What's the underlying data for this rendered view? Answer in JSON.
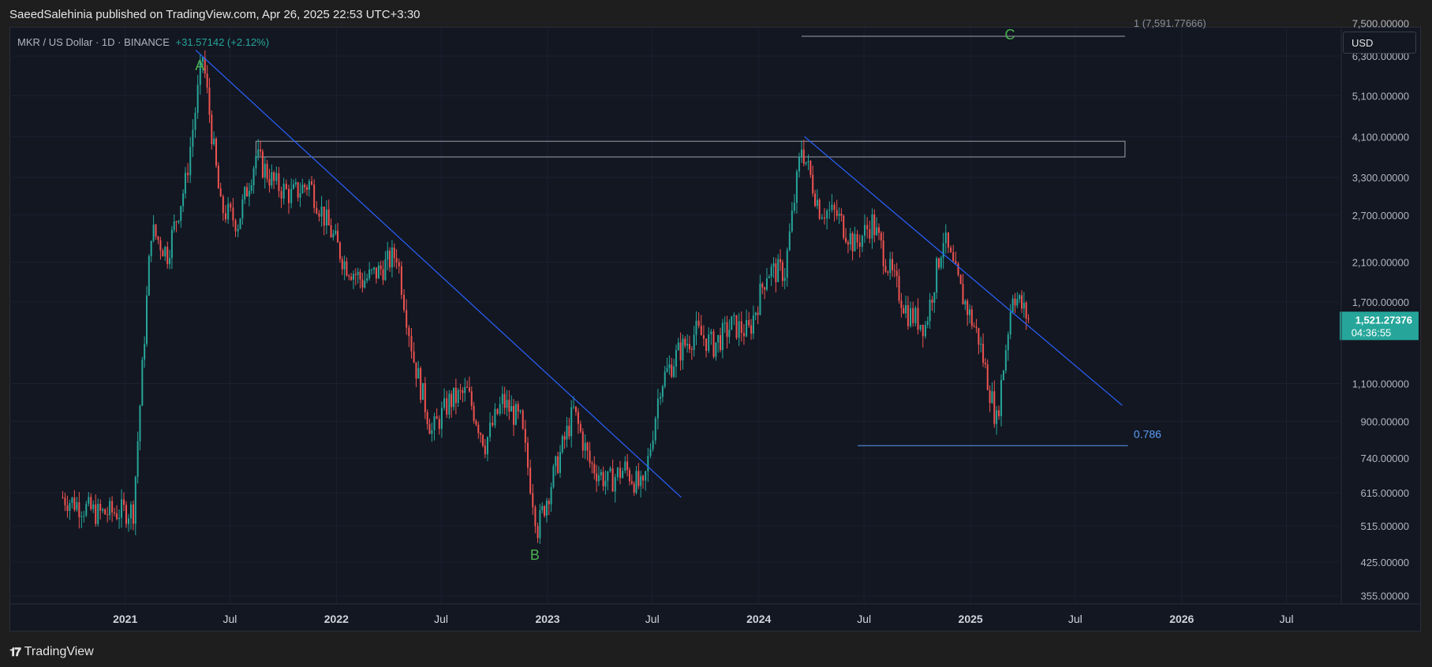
{
  "header": {
    "publish_text": "SaeedSalehinia published on TradingView.com, Apr 26, 2025 22:53 UTC+3:30"
  },
  "symbol": {
    "title": "MKR / US Dollar · 1D · BINANCE",
    "change": "+31.57142 (+2.12%)"
  },
  "currency_button": "USD",
  "footer": {
    "brand": "TradingView"
  },
  "colors": {
    "background": "#131722",
    "up": "#26a69a",
    "down": "#ef5350",
    "trendline": "#2962ff",
    "wave_label": "#4caf50",
    "fib": "#5b9cf6"
  },
  "chart_data": {
    "type": "line",
    "scale": "log",
    "x_labels": [
      "2021",
      "Jul",
      "2022",
      "Jul",
      "2023",
      "Jul",
      "2024",
      "Jul",
      "2025",
      "Jul",
      "2026",
      "Jul"
    ],
    "y_labels": [
      "7,500.00000",
      "6,300.00000",
      "5,100.00000",
      "4,100.00000",
      "3,300.00000",
      "2,700.00000",
      "2,100.00000",
      "1,700.00000",
      "1,100.00000",
      "900.00000",
      "740.00000",
      "615.00000",
      "515.00000",
      "425.00000",
      "355.00000"
    ],
    "last_price": "1,521.27376",
    "countdown": "04:36:55",
    "wave_labels": [
      {
        "text": "A",
        "x": "2021-05",
        "y": 6300
      },
      {
        "text": "B",
        "x": "2022-12",
        "y": 470
      },
      {
        "text": "C",
        "x": "2025-03",
        "y": 7591.77666
      }
    ],
    "annotations": [
      {
        "text": "1 (7,591.77666)",
        "value": 7591.77666
      },
      {
        "text": "0.786",
        "value": 790
      }
    ],
    "resistance_zone": [
      3680,
      4000
    ],
    "trendlines": [
      {
        "from": [
          "2021-05-03",
          6500
        ],
        "to": [
          "2023-08-20",
          600
        ]
      },
      {
        "from": [
          "2024-03-20",
          4100
        ],
        "to": [
          "2025-09-20",
          980
        ]
      }
    ],
    "series": [
      {
        "x": [
          "2020-09",
          "2020-11",
          "2021-01",
          "2021-02",
          "2021-03",
          "2021-04",
          "2021-05",
          "2021-06",
          "2021-07",
          "2021-08",
          "2021-09",
          "2021-10",
          "2021-11",
          "2021-12",
          "2022-01",
          "2022-02",
          "2022-03",
          "2022-04",
          "2022-05",
          "2022-06",
          "2022-07",
          "2022-08",
          "2022-09",
          "2022-10",
          "2022-11",
          "2022-12",
          "2023-01",
          "2023-02",
          "2023-03",
          "2023-04",
          "2023-05",
          "2023-06",
          "2023-07",
          "2023-08",
          "2023-09",
          "2023-10",
          "2023-11",
          "2023-12",
          "2024-01",
          "2024-02",
          "2024-03",
          "2024-04",
          "2024-05",
          "2024-06",
          "2024-07",
          "2024-08",
          "2024-09",
          "2024-10",
          "2024-11",
          "2024-12",
          "2025-01",
          "2025-02",
          "2025-03",
          "2025-04"
        ],
        "values": [
          600,
          550,
          560,
          2500,
          2200,
          3200,
          6300,
          2800,
          2600,
          3700,
          3200,
          3000,
          3200,
          2600,
          2100,
          1900,
          2000,
          2200,
          1250,
          850,
          1000,
          1050,
          800,
          1000,
          900,
          510,
          700,
          950,
          720,
          650,
          700,
          620,
          1100,
          1300,
          1450,
          1350,
          1500,
          1450,
          2000,
          2000,
          3900,
          2800,
          2700,
          2300,
          2600,
          2000,
          1600,
          1500,
          2400,
          1800,
          1400,
          900,
          1800,
          1521
        ]
      }
    ]
  }
}
